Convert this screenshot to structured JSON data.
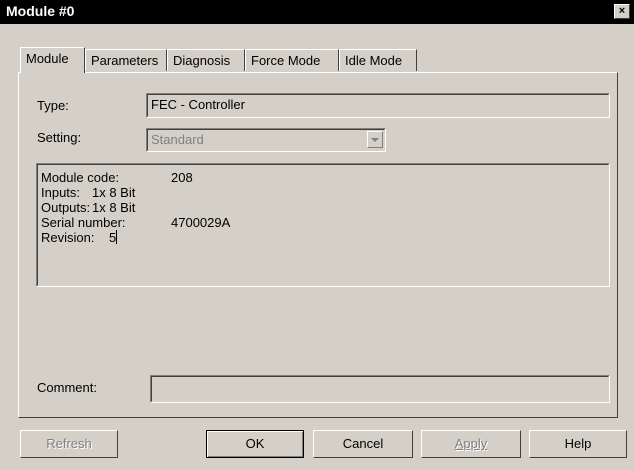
{
  "window": {
    "title": "Module #0",
    "close_label": "×"
  },
  "tabs": [
    {
      "label": "Module"
    },
    {
      "label": "Parameters"
    },
    {
      "label": "Diagnosis"
    },
    {
      "label": "Force Mode"
    },
    {
      "label": "Idle Mode"
    }
  ],
  "module": {
    "type_label": "Type:",
    "type_value": "FEC - Controller",
    "setting_label": "Setting:",
    "setting_value": "Standard",
    "info": {
      "module_code_label": "Module code:",
      "module_code_value": "208",
      "inputs_label": "Inputs:",
      "inputs_value": "1x 8 Bit",
      "outputs_label": "Outputs:",
      "outputs_value": "1x 8 Bit",
      "serial_label": "Serial number:",
      "serial_value": "4700029A",
      "revision_label": "Revision:",
      "revision_value": "5"
    },
    "comment_label": "Comment:",
    "comment_value": ""
  },
  "buttons": {
    "refresh": "Refresh",
    "ok": "OK",
    "cancel": "Cancel",
    "apply": "Apply",
    "help": "Help"
  }
}
